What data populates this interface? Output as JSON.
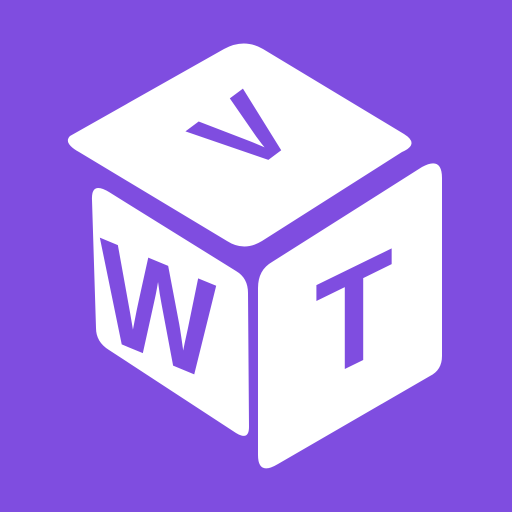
{
  "logo": {
    "letters": {
      "top": "V",
      "left": "W",
      "right": "T"
    },
    "colors": {
      "background": "#7F4DE0",
      "cube": "#FFFFFF",
      "letters": "#7F4DE0"
    },
    "icon_name": "letter-cube-icon"
  }
}
